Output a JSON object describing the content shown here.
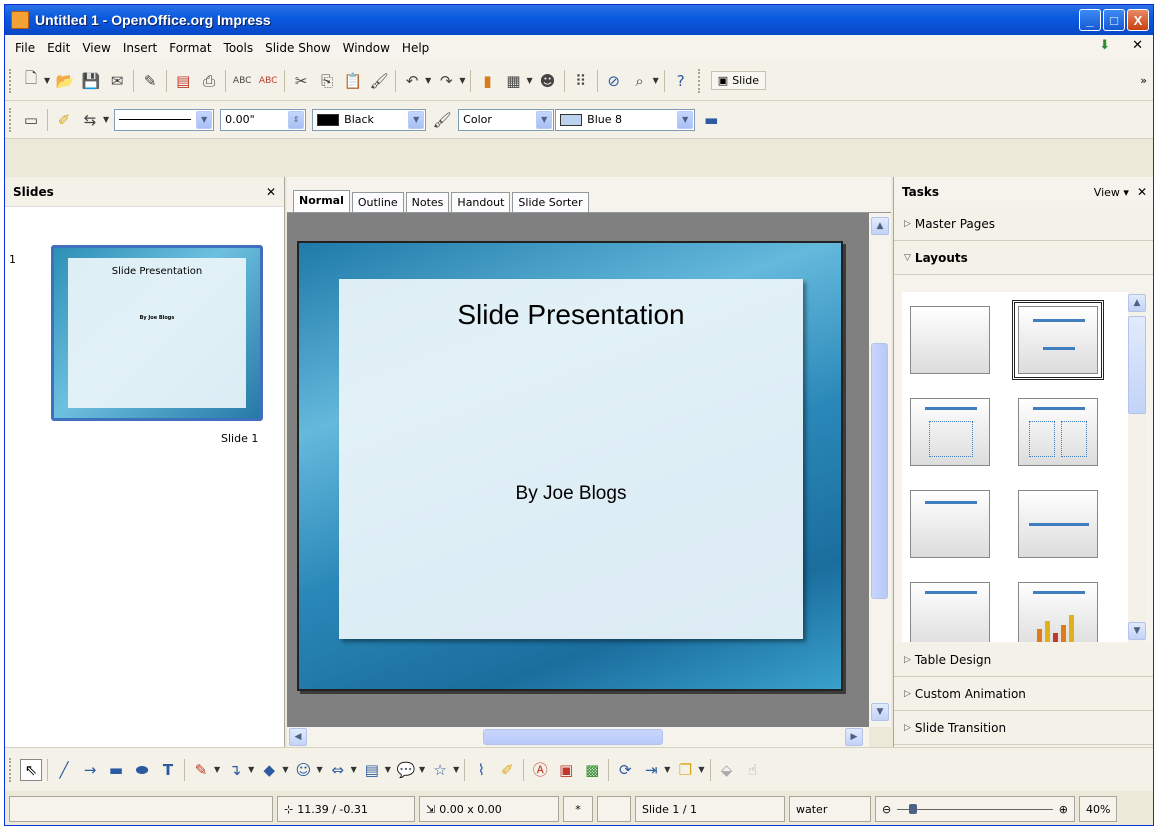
{
  "window": {
    "title": "Untitled 1 - OpenOffice.org Impress",
    "min": "_",
    "max": "□",
    "close": "X"
  },
  "menu": [
    "File",
    "Edit",
    "View",
    "Insert",
    "Format",
    "Tools",
    "Slide Show",
    "Window",
    "Help"
  ],
  "toolbar2": {
    "line_width": "0.00\"",
    "line_color": "Black",
    "fill_type": "Color",
    "fill_color": "Blue 8",
    "slide_button": "Slide"
  },
  "slides_pane": {
    "title": "Slides",
    "thumb_number": "1",
    "thumb_label": "Slide 1",
    "thumb_title": "Slide Presentation",
    "thumb_sub": "By Joe Blogs"
  },
  "tabs": [
    "Normal",
    "Outline",
    "Notes",
    "Handout",
    "Slide Sorter"
  ],
  "slide": {
    "title": "Slide Presentation",
    "subtitle": "By Joe Blogs"
  },
  "tasks": {
    "title": "Tasks",
    "view": "View",
    "sections_top": [
      "Master Pages",
      "Layouts"
    ],
    "sections_bottom": [
      "Table Design",
      "Custom Animation",
      "Slide Transition"
    ]
  },
  "status": {
    "position": "11.39 / -0.31",
    "size": "0.00 x 0.00",
    "modified": "*",
    "slide": "Slide 1 / 1",
    "master": "water",
    "zoom": "40%"
  },
  "colors": {
    "titlebar": "#0a5be0",
    "accent": "#3f7fbf",
    "black_swatch": "#000000",
    "blue8_swatch": "#b9d3ec"
  }
}
